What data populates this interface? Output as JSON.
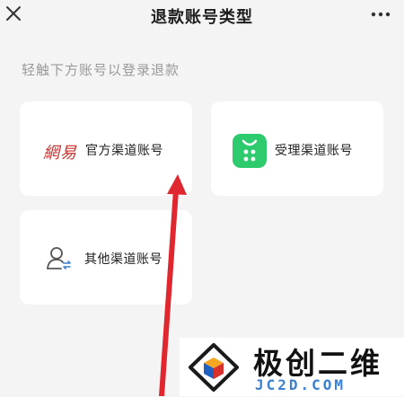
{
  "header": {
    "title": "退款账号类型",
    "close_icon": "close-icon",
    "more_icon": "more-horizontal-icon"
  },
  "hint": "轻触下方账号以登录退款",
  "cards": [
    {
      "id": "official",
      "label": "官方渠道账号",
      "logo_text": "網易",
      "icon": "netease-logo"
    },
    {
      "id": "agent",
      "label": "受理渠道账号",
      "icon": "app-store-bag-icon",
      "icon_color": "#2ecb6e"
    },
    {
      "id": "other",
      "label": "其他渠道账号",
      "icon": "person-switch-icon"
    }
  ],
  "watermark": {
    "title": "极创二维",
    "url": "JC2D.COM"
  },
  "colors": {
    "background": "#f4f4f4",
    "card": "#ffffff",
    "hint": "#9a9a9a",
    "arrow": "#e0262e",
    "netease_red": "#c9302c",
    "watermark_url": "#3b7fd1"
  }
}
